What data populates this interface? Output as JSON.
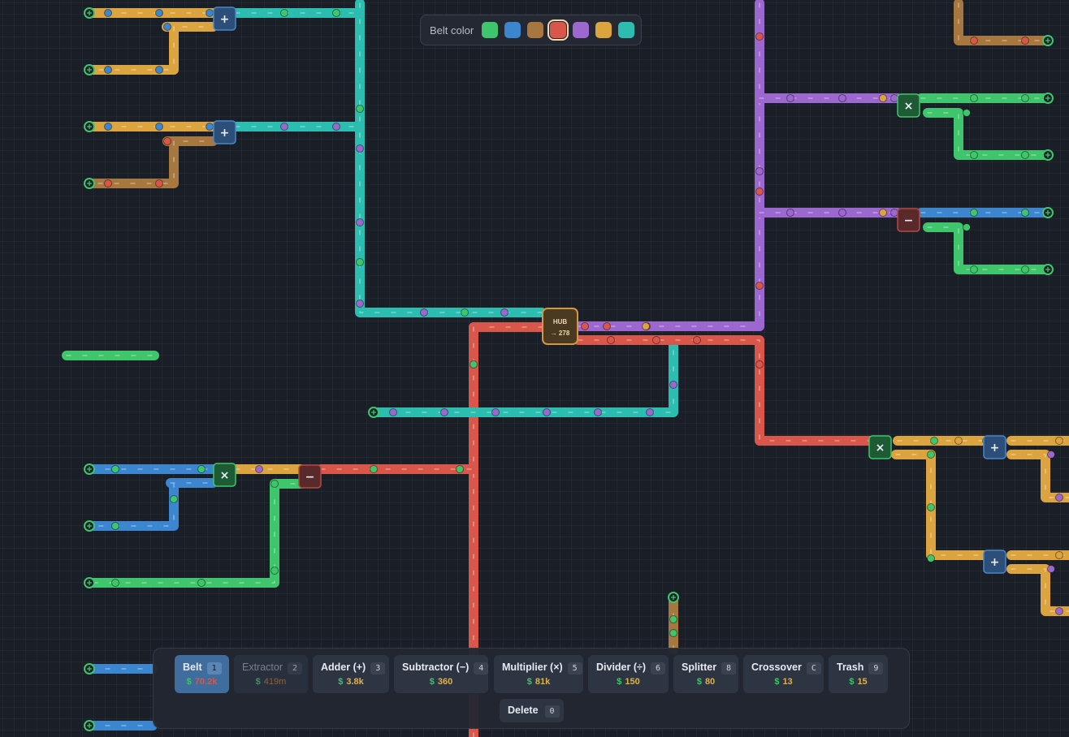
{
  "palette": {
    "label": "Belt color",
    "colors": [
      {
        "name": "green",
        "hex": "#3fc56b"
      },
      {
        "name": "blue",
        "hex": "#3c86d0"
      },
      {
        "name": "brown",
        "hex": "#a6773e"
      },
      {
        "name": "red",
        "hex": "#d9564b"
      },
      {
        "name": "purple",
        "hex": "#9c67cf"
      },
      {
        "name": "yellow",
        "hex": "#dca43e"
      },
      {
        "name": "teal",
        "hex": "#2bbdb0"
      }
    ],
    "selected": "red"
  },
  "hub": {
    "label": "HUB",
    "count": "→ 278"
  },
  "machines": [
    {
      "type": "adder",
      "symbol": "+"
    },
    {
      "type": "adder",
      "symbol": "+"
    },
    {
      "type": "multiplier",
      "symbol": "×"
    },
    {
      "type": "subtractor",
      "symbol": "−"
    },
    {
      "type": "multiplier",
      "symbol": "×"
    },
    {
      "type": "subtractor",
      "symbol": "−"
    },
    {
      "type": "multiplier",
      "symbol": "×"
    },
    {
      "type": "adder",
      "symbol": "+"
    },
    {
      "type": "adder",
      "symbol": "+"
    }
  ],
  "toolbar": {
    "tools": [
      {
        "name": "Belt",
        "key": "1",
        "cost": "70.2k",
        "state": "active"
      },
      {
        "name": "Extractor",
        "key": "2",
        "cost": "419m",
        "state": "disabled"
      },
      {
        "name": "Adder (+)",
        "key": "3",
        "cost": "3.8k",
        "state": "normal"
      },
      {
        "name": "Subtractor (−)",
        "key": "4",
        "cost": "360",
        "state": "normal"
      },
      {
        "name": "Multiplier (×)",
        "key": "5",
        "cost": "81k",
        "state": "normal"
      },
      {
        "name": "Divider (÷)",
        "key": "6",
        "cost": "150",
        "state": "normal"
      },
      {
        "name": "Splitter",
        "key": "8",
        "cost": "80",
        "state": "normal"
      },
      {
        "name": "Crossover",
        "key": "C",
        "cost": "13",
        "state": "normal"
      },
      {
        "name": "Trash",
        "key": "9",
        "cost": "15",
        "state": "normal"
      }
    ],
    "currency_symbol": "$",
    "delete": {
      "label": "Delete",
      "key": "0"
    }
  },
  "icons": {
    "extractor_icon": "extractor-port-icon",
    "belt_arrow": "chevron-right-icon"
  }
}
